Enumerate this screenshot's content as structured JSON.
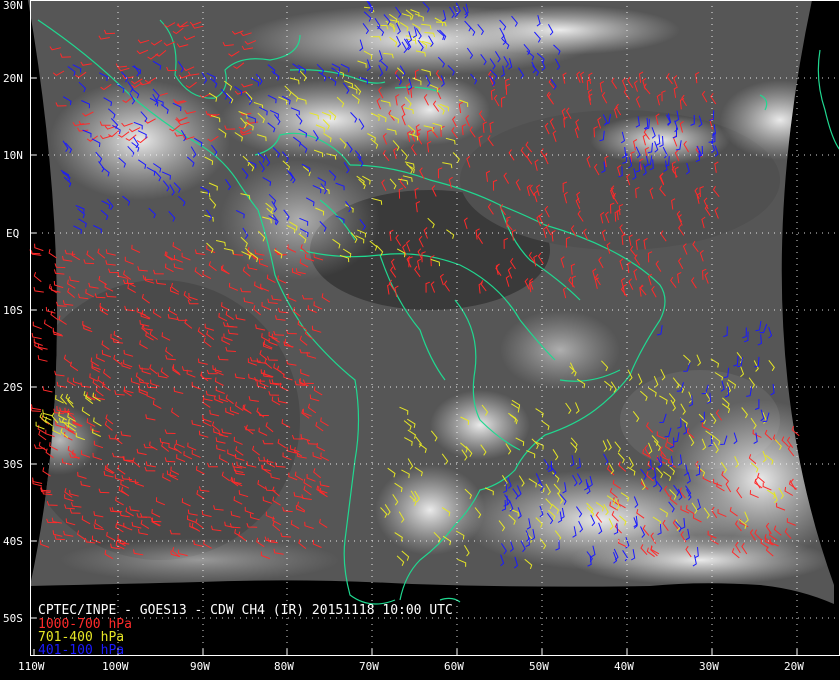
{
  "map": {
    "caption": {
      "title": "CPTEC/INPE - GOES13 - CDW CH4 (IR) 20151118 10:00 UTC"
    },
    "legend": [
      {
        "label": "1000-700 hPa",
        "color": "#ff2a2a"
      },
      {
        "label": "701-400 hPa",
        "color": "#e6e626"
      },
      {
        "label": "401-100 hPa",
        "color": "#1a1aff"
      }
    ],
    "lat_labels": [
      "30N",
      "20N",
      "10N",
      "EQ",
      "10S",
      "20S",
      "30S",
      "40S",
      "50S"
    ],
    "lon_labels": [
      "110W",
      "100W",
      "90W",
      "80W",
      "70W",
      "60W",
      "50W",
      "40W",
      "30W",
      "20W"
    ],
    "colors": {
      "coastline": "#20d890",
      "grid": "#ffffff",
      "background": "#000000"
    }
  }
}
